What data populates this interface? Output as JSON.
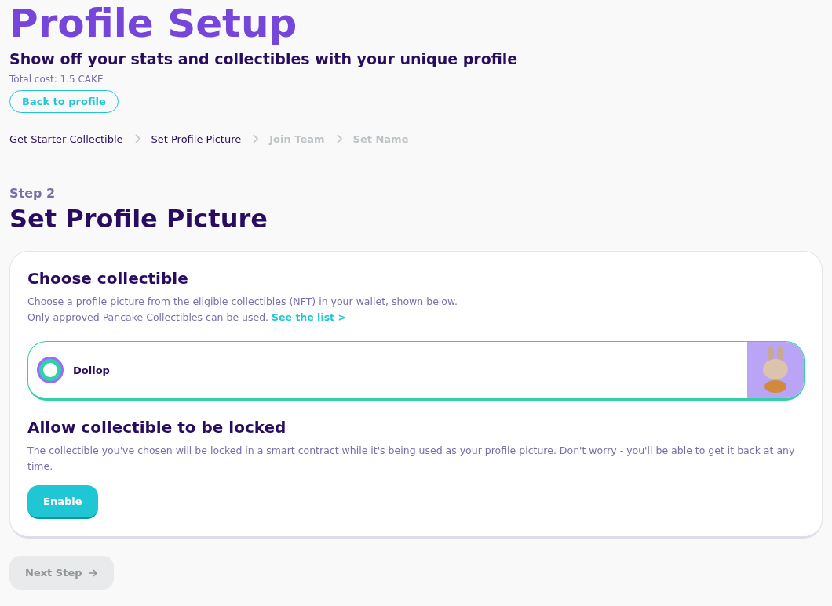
{
  "title": "Profile Setup",
  "subtitle": "Show off your stats and collectibles with your unique profile",
  "total_cost": "Total cost: 1.5 CAKE",
  "back_button": "Back to profile",
  "breadcrumbs": [
    {
      "label": "Get Starter Collectible",
      "reached": true
    },
    {
      "label": "Set Profile Picture",
      "reached": true
    },
    {
      "label": "Join Team",
      "reached": false
    },
    {
      "label": "Set Name",
      "reached": false
    }
  ],
  "step_label": "Step 2",
  "step_title": "Set Profile Picture",
  "card": {
    "choose_title": "Choose collectible",
    "choose_text_1": "Choose a profile picture from the eligible collectibles (NFT) in your wallet, shown below.",
    "choose_text_2": "Only approved Pancake Collectibles can be used.",
    "link": "See the list >",
    "collectibles": [
      {
        "name": "Dollop",
        "selected": true
      }
    ],
    "lock_title": "Allow collectible to be locked",
    "lock_text": "The collectible you've chosen will be locked in a smart contract while it's being used as your profile picture. Don't worry - you'll be able to get it back at any time.",
    "enable_button": "Enable"
  },
  "next_button": {
    "label": "Next Step",
    "disabled": true
  }
}
